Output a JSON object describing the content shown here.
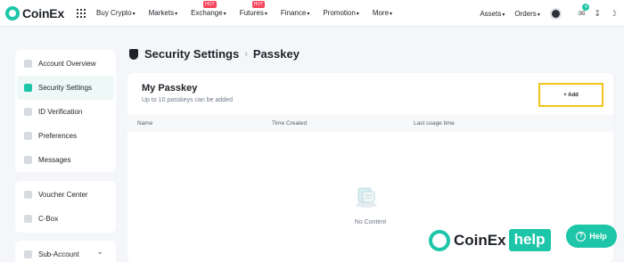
{
  "brand": {
    "name": "CoinEx"
  },
  "nav": {
    "items": [
      {
        "label": "Buy Crypto",
        "hot": ""
      },
      {
        "label": "Markets",
        "hot": ""
      },
      {
        "label": "Exchange",
        "hot": "HOT"
      },
      {
        "label": "Futures",
        "hot": "HOT"
      },
      {
        "label": "Finance",
        "hot": ""
      },
      {
        "label": "Promotion",
        "hot": ""
      },
      {
        "label": "More",
        "hot": ""
      }
    ],
    "right": {
      "assets": "Assets",
      "orders": "Orders",
      "notif_count": "4"
    },
    "caret": "▾"
  },
  "sidebar": {
    "group1": [
      "Account Overview",
      "Security Settings",
      "ID Verification",
      "Preferences",
      "Messages"
    ],
    "group2": [
      "Voucher Center",
      "C-Box"
    ],
    "group3": [
      "Sub-Account"
    ],
    "chevron": "⌄"
  },
  "breadcrumb": {
    "section": "Security Settings",
    "sep": "›",
    "current": "Passkey"
  },
  "panel": {
    "title": "My Passkey",
    "subtitle": "Up to 10 passkeys can be added",
    "add_label": "+ Add",
    "columns": [
      "Name",
      "Time Created",
      "Last usage time"
    ],
    "empty_text": "No Content"
  },
  "watermark": {
    "text": "CoinEx",
    "help": "help"
  },
  "help_button": {
    "label": "Help",
    "icon": "?"
  },
  "colors": {
    "accent": "#1dc6a8",
    "highlight": "#f0c419",
    "hot": "#f5465c"
  }
}
